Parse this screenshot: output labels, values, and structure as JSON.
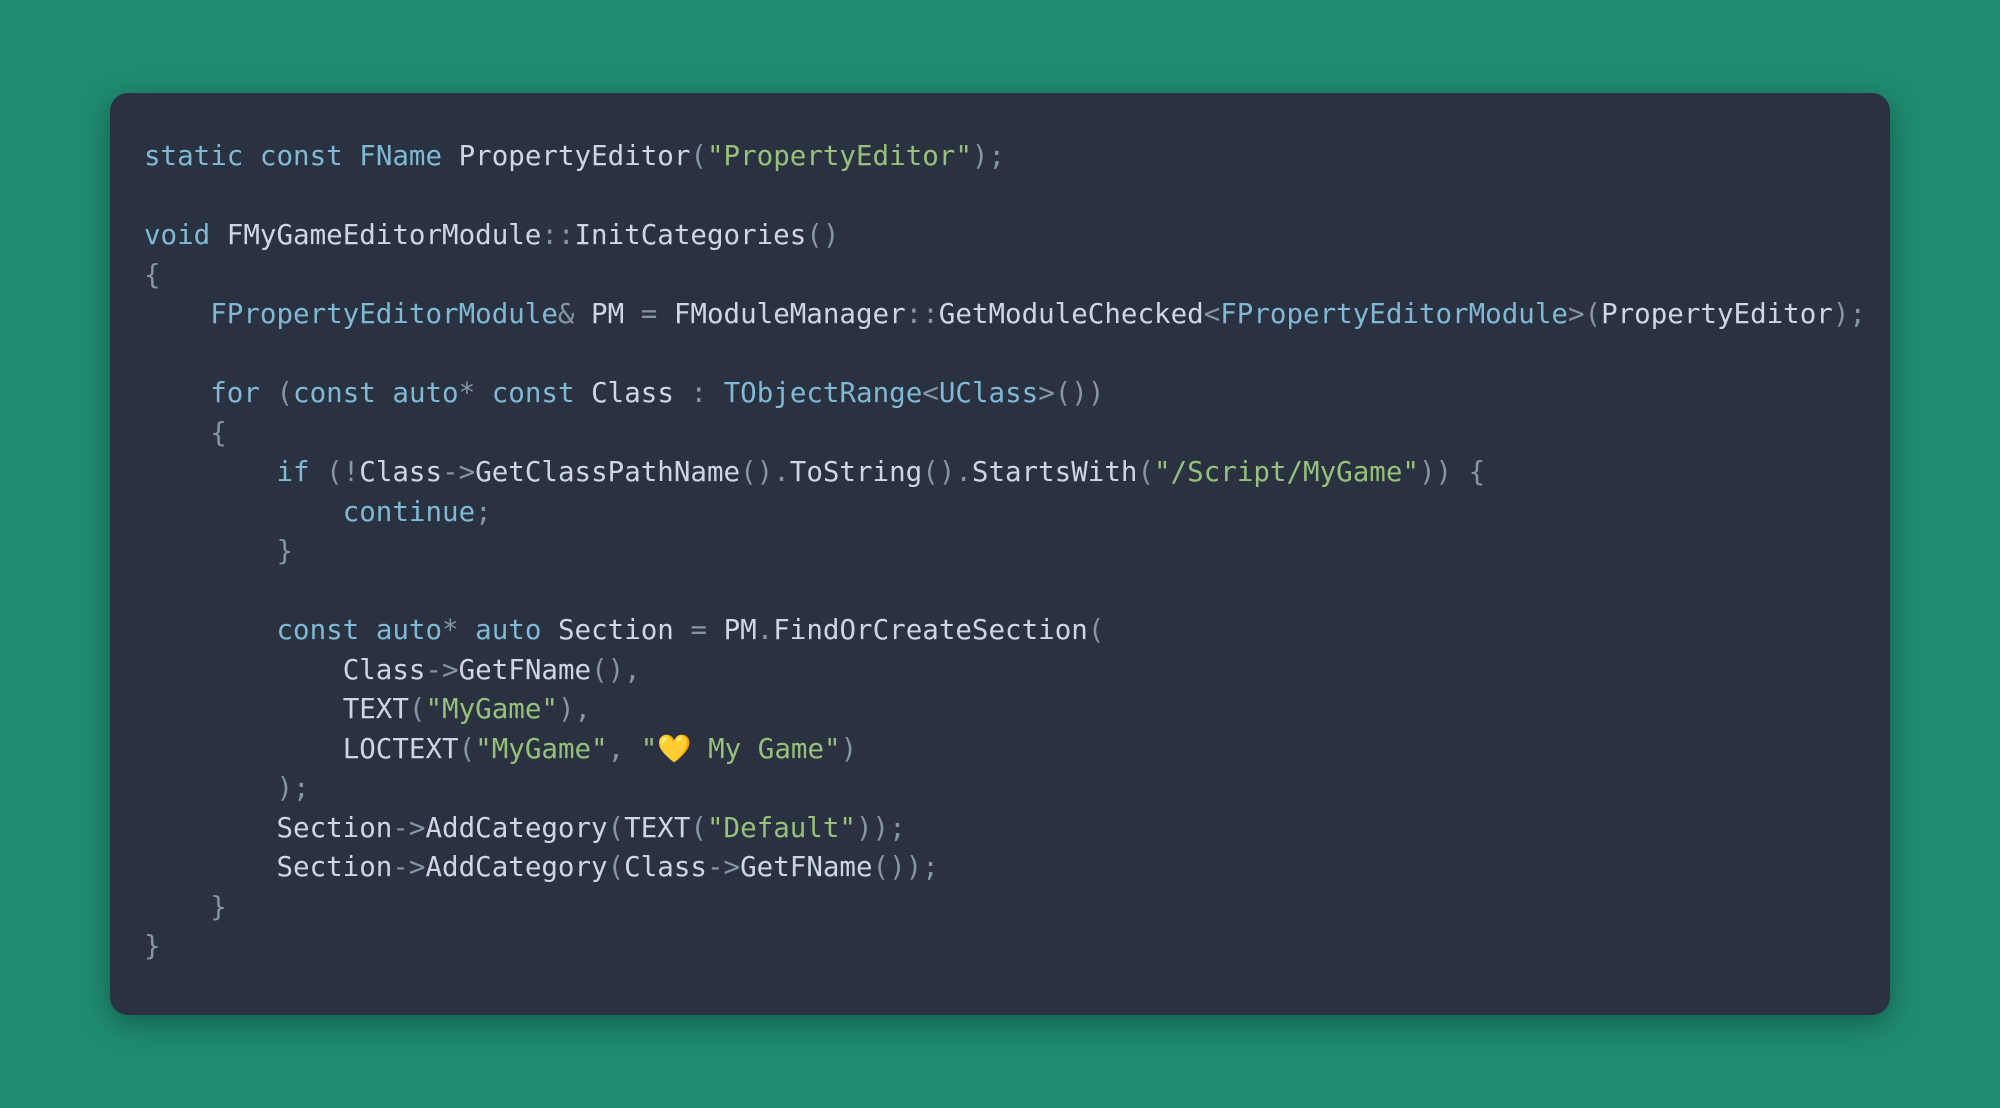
{
  "code": {
    "l01": {
      "kw_static": "static",
      "kw_const": "const",
      "type_fname": "FName",
      "id_pe": "PropertyEditor",
      "str_pe": "\"PropertyEditor\""
    },
    "l03": {
      "kw_void": "void",
      "id_cls": "FMyGameEditorModule",
      "id_fn": "InitCategories"
    },
    "l05": {
      "type_fpem": "FPropertyEditorModule",
      "id_pm": "PM",
      "fn_fmm": "FModuleManager",
      "fn_getmod": "GetModuleChecked",
      "id_arg": "PropertyEditor"
    },
    "l07": {
      "kw_for": "for",
      "kw_const1": "const",
      "kw_auto": "auto",
      "kw_const2": "const",
      "id_class": "Class",
      "type_tobj": "TObjectRange",
      "type_uclass": "UClass"
    },
    "l09": {
      "kw_if": "if",
      "id_class": "Class",
      "fn_gcpn": "GetClassPathName",
      "fn_tostr": "ToString",
      "fn_sw": "StartsWith",
      "str_path": "\"/Script/MyGame\""
    },
    "l10": {
      "kw_continue": "continue"
    },
    "l13": {
      "kw_const": "const",
      "kw_auto1": "auto",
      "kw_auto2": "auto",
      "id_section": "Section",
      "id_pm": "PM",
      "fn_focs": "FindOrCreateSection"
    },
    "l14": {
      "id_class": "Class",
      "fn_getfname": "GetFName"
    },
    "l15": {
      "fn_text": "TEXT",
      "str_mygame": "\"MyGame\""
    },
    "l16": {
      "fn_loctext": "LOCTEXT",
      "str_key": "\"MyGame\"",
      "str_open": "\"",
      "emoji": "💛",
      "str_rest": " My Game\""
    },
    "l18": {
      "id_section": "Section",
      "fn_addcat": "AddCategory",
      "fn_text": "TEXT",
      "str_default": "\"Default\""
    },
    "l19": {
      "id_section": "Section",
      "fn_addcat": "AddCategory",
      "id_class": "Class",
      "fn_getfname": "GetFName"
    }
  }
}
